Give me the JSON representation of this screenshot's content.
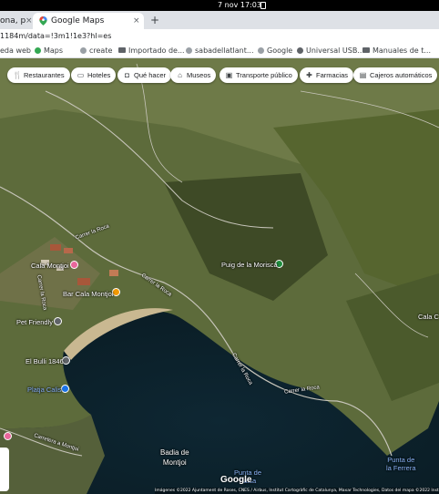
{
  "os": {
    "clock": "7 nov  17:03"
  },
  "browser": {
    "tabs": [
      {
        "label": "ona, p",
        "close": "×"
      },
      {
        "label": "Google Maps",
        "close": "×"
      }
    ],
    "new_tab": "+",
    "url": "1184m/data=!3m1!1e3?hl=es",
    "bookmarks": [
      "eda web",
      "Maps",
      "create",
      "Importado de...",
      "sabadellatlant...",
      "Google",
      "Universal USB...",
      "Manuales de t..."
    ]
  },
  "map": {
    "chips": [
      "Restaurantes",
      "Hoteles",
      "Qué hacer",
      "Museos",
      "Transporte público",
      "Farmacias",
      "Cajeros automáticos"
    ],
    "places": {
      "puig": "Puig de la Morisca",
      "cala_montjoi": "Cala Montjoi",
      "bar": "Bar Cala Montjoi",
      "pet": "Pet Friendly",
      "bulli": "El Bulli 1846",
      "calis": "Platja Calis",
      "cala_right": "Cala C",
      "punta_ferrera": "Punta de\nla Ferrera",
      "punta_bottom": "Punta de\nFalsa",
      "badia": "Badia de\nMontjoi"
    },
    "roads": {
      "r1": "Carrer la Roca",
      "r2": "Carrer la Roca",
      "r3": "Carrer la Roca",
      "r4": "Carrer la Roca",
      "r5": "Carretera a Montjoi",
      "r6": "Carrer la Roca"
    },
    "logo": "Google",
    "attribution": "Imágenes ©2022 Ajuntament de Roses, CNES / Airbus, Institut Cartogràfic de Catalunya, Maxar Technologies, Datos del mapa ©2022 Inst. G"
  }
}
